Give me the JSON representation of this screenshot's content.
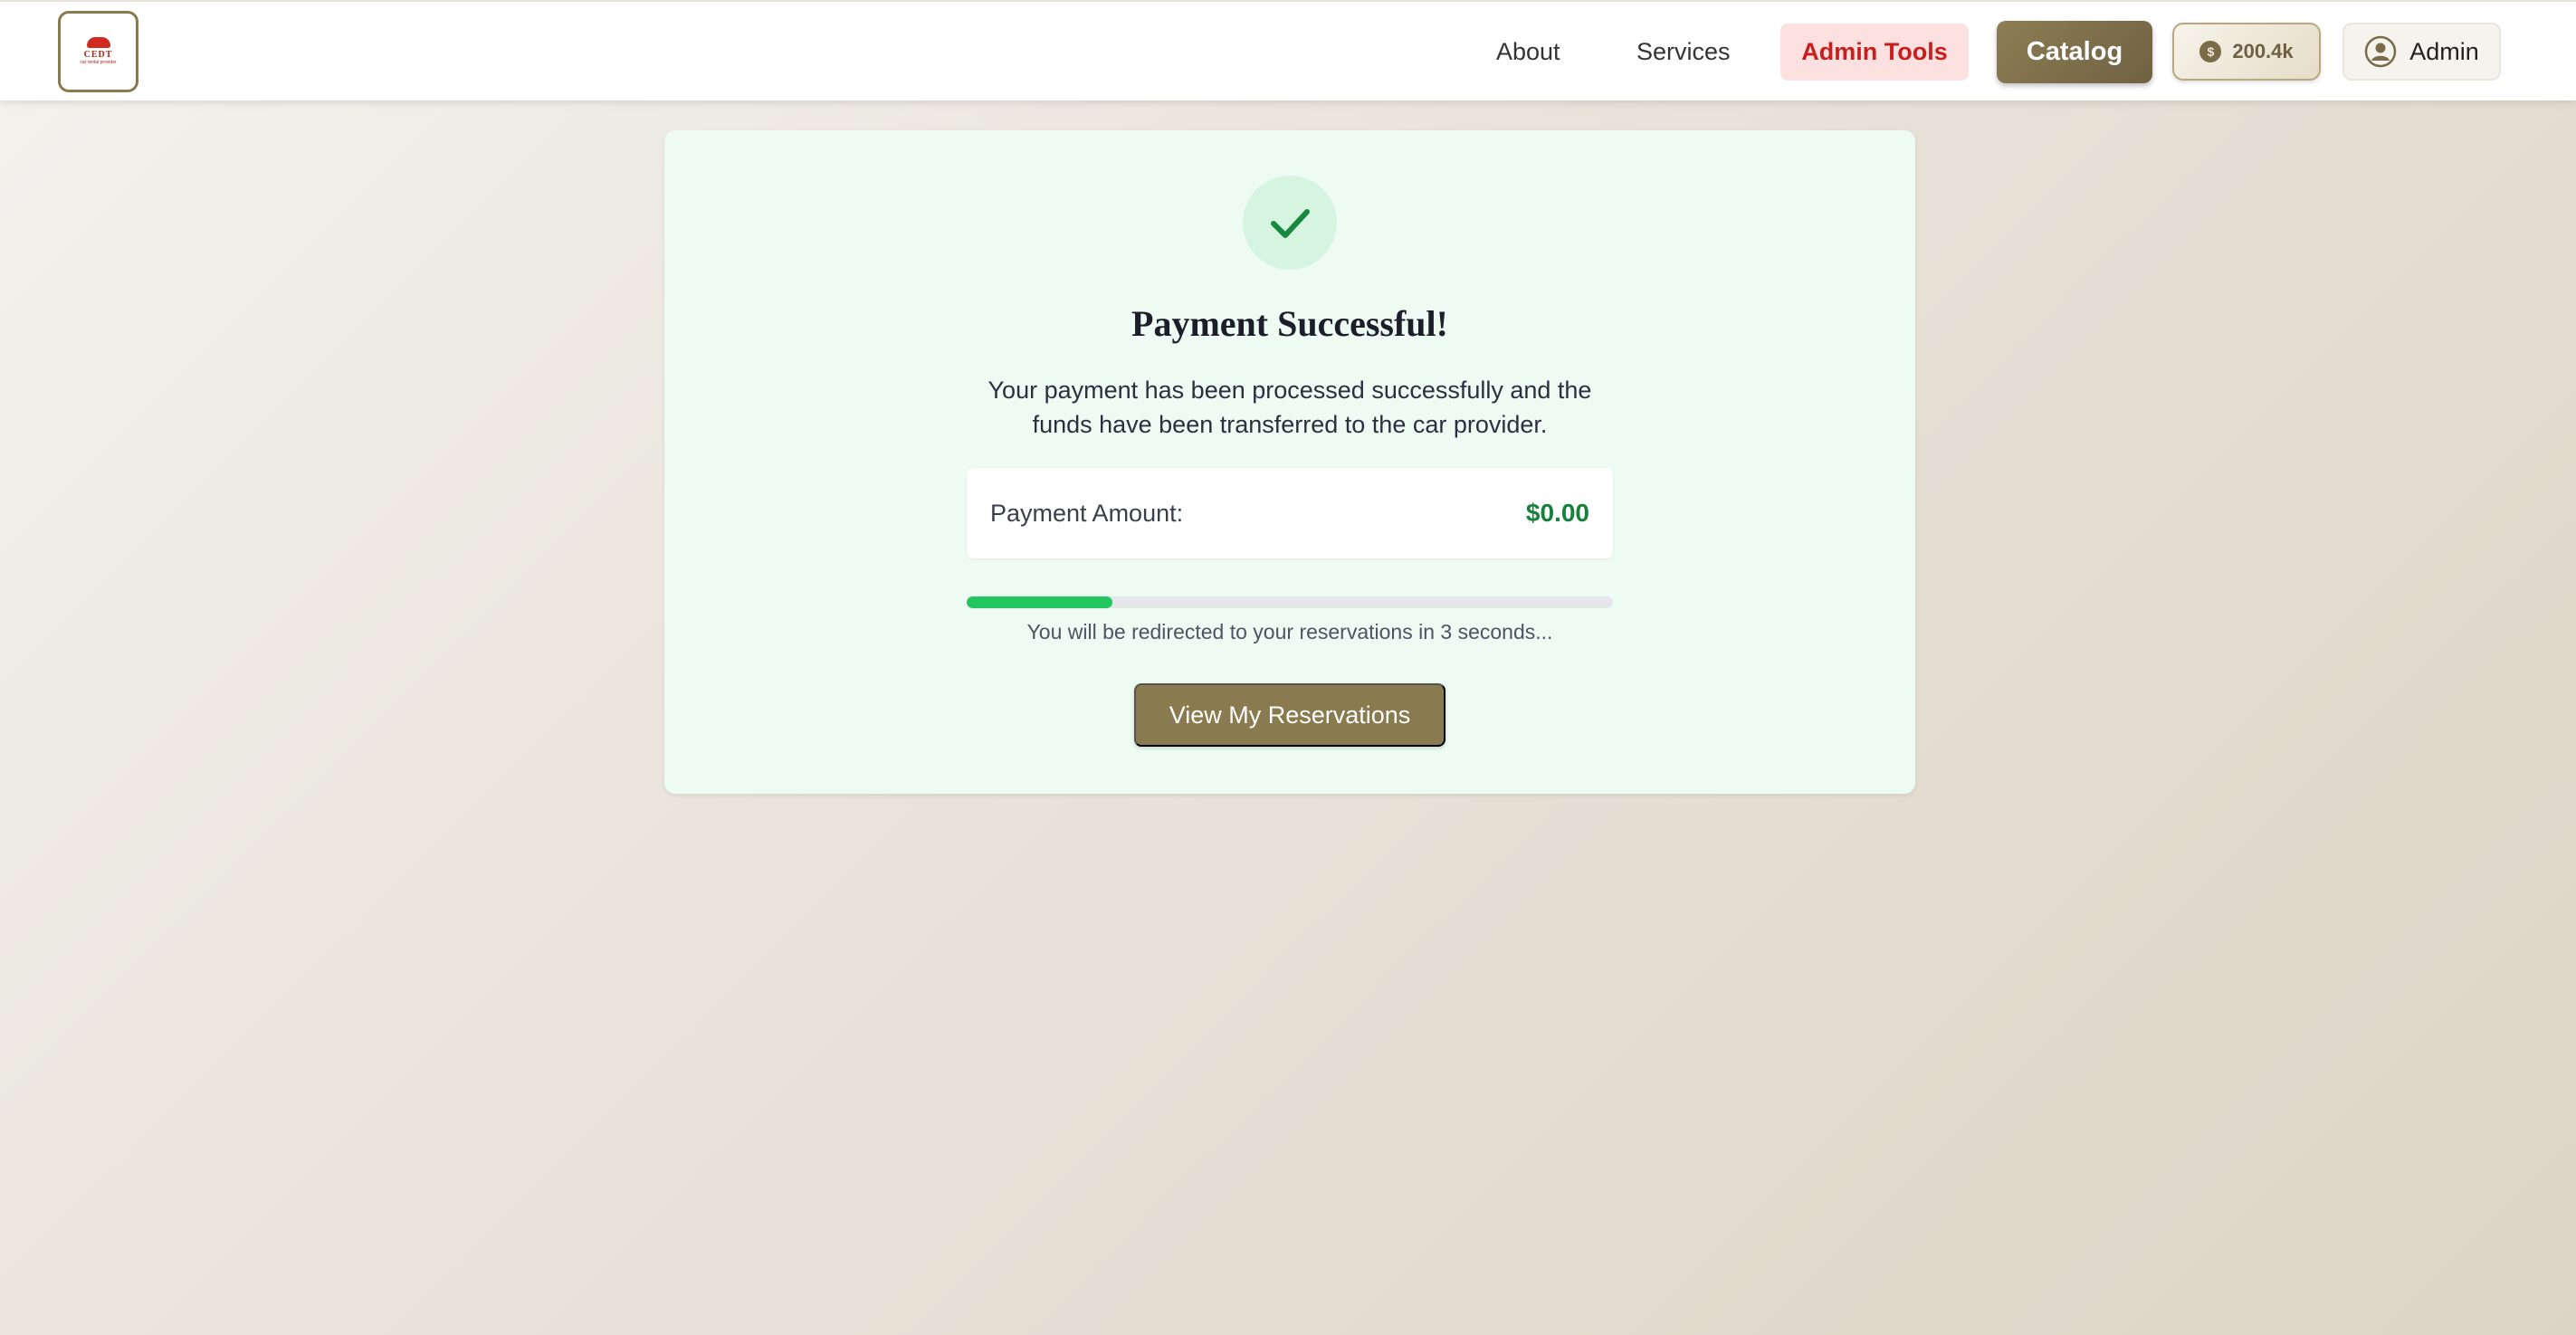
{
  "navbar": {
    "logo": {
      "text": "CEDT",
      "subtext": "car rental provider"
    },
    "links": [
      {
        "label": "About"
      },
      {
        "label": "Services"
      }
    ],
    "admin_tools_label": "Admin Tools",
    "catalog_label": "Catalog",
    "balance": {
      "icon": "coin-icon",
      "symbol": "$",
      "value": "200.4k"
    },
    "user": {
      "icon": "user-circle-icon",
      "label": "Admin"
    }
  },
  "card": {
    "icon": "checkmark-icon",
    "title": "Payment Successful!",
    "message": "Your payment has been processed successfully and the funds have been transferred to the car provider.",
    "amount_label": "Payment Amount:",
    "amount_value": "$0.00",
    "progress_fraction": 0.225,
    "redirect_text": "You will be redirected to your reservations in 3 seconds...",
    "button_label": "View My Reservations"
  },
  "colors": {
    "accent": "#8a7a4f",
    "success": "#22c55e",
    "admin_tools_bg": "#fde1e1",
    "admin_tools_text": "#c81e1e",
    "card_bg": "#eefbf2"
  }
}
